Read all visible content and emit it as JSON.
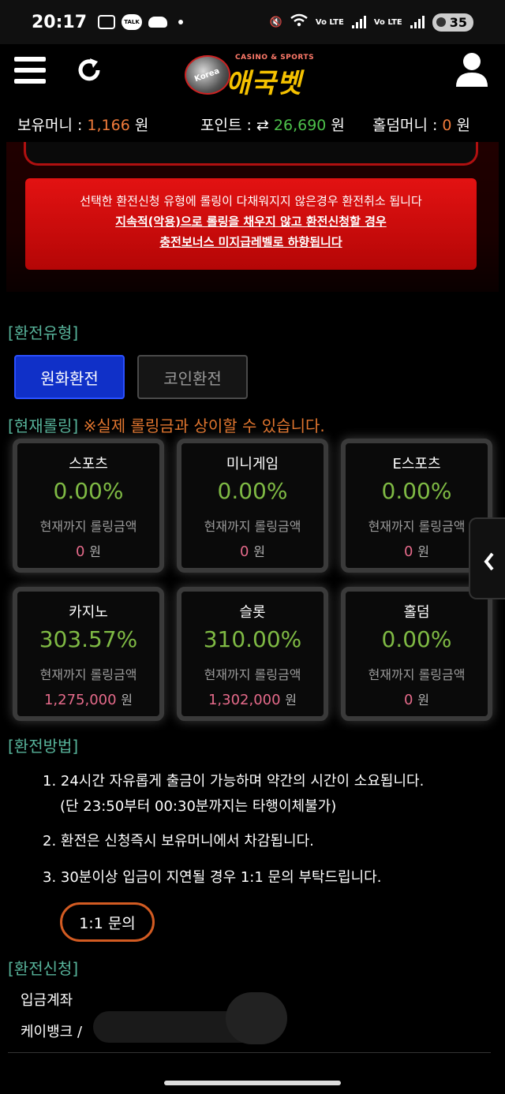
{
  "status_bar": {
    "time": "20:17",
    "battery": "35",
    "signal_labels": [
      "Vo LTE",
      "Vo LTE"
    ]
  },
  "header": {
    "logo_text": "애국벳",
    "logo_tagline": "CASINO & SPORTS",
    "logo_badge": "Korea"
  },
  "balances": {
    "money_label": "보유머니 : ",
    "money_value": "1,166",
    "money_unit": " 원",
    "point_label": "포인트 : ⇄ ",
    "point_value": "26,690",
    "point_unit": " 원",
    "holdem_label": "홀덤머니 : ",
    "holdem_value": "0",
    "holdem_unit": " 원"
  },
  "notice": {
    "line1": "선택한 환전신청 유형에 롤링이 다채워지지 않은경우 환전취소 됩니다",
    "line2": "지속적(악용)으로 롤링을 채우지 않고 환전신청할 경우",
    "line3": "충전보너스 미지급레벨로 하향됩니다"
  },
  "exchange_type": {
    "heading": "[환전유형]",
    "tabs": [
      {
        "label": "원화환전",
        "active": true
      },
      {
        "label": "코인환전",
        "active": false
      }
    ]
  },
  "rolling": {
    "heading": "[현재롤링]",
    "warning": "※실제 롤링금과 상이할 수 있습니다.",
    "unit": "원",
    "cards": [
      {
        "title": "스포츠",
        "percent": "0.00%",
        "label": "현재까지 롤링금액",
        "amount": "0"
      },
      {
        "title": "미니게임",
        "percent": "0.00%",
        "label": "현재까지 롤링금액",
        "amount": "0"
      },
      {
        "title": "E스포츠",
        "percent": "0.00%",
        "label": "현재까지 롤링금액",
        "amount": "0"
      },
      {
        "title": "카지노",
        "percent": "303.57%",
        "label": "현재까지 롤링금액",
        "amount": "1,275,000"
      },
      {
        "title": "슬롯",
        "percent": "310.00%",
        "label": "현재까지 롤링금액",
        "amount": "1,302,000"
      },
      {
        "title": "홀덤",
        "percent": "0.00%",
        "label": "현재까지 롤링금액",
        "amount": "0"
      }
    ]
  },
  "method": {
    "heading": "[환전방법]",
    "items": [
      "1. 24시간 자유롭게 출금이 가능하며 약간의 시간이 소요됩니다.",
      "(단 23:50부터 00:30분까지는 타행이체불가)",
      "2. 환전은 신청즉시 보유머니에서 차감됩니다.",
      "3. 30분이상 입금이 지연될 경우 1:1 문의 부탁드립니다."
    ],
    "inquiry_button": "1:1 문의"
  },
  "request": {
    "heading": "[환전신청]",
    "account_label": "입금계좌",
    "bank_label": "케이뱅크 /"
  },
  "colors": {
    "accent_green": "#4cc04a",
    "accent_orange": "#ef7a3a",
    "notice_red": "#d90f0f",
    "active_tab": "#1030c8",
    "section_teal": "#57b39a"
  }
}
